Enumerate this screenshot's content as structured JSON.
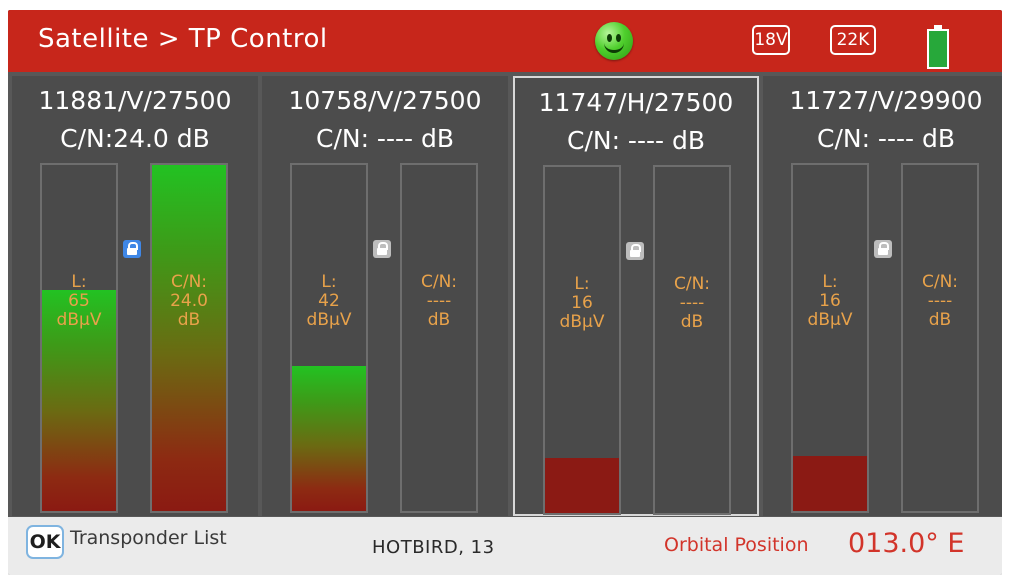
{
  "header": {
    "title": "Satellite > TP Control",
    "status_icon": "smiley-face-icon",
    "voltage_badge": "18V",
    "tone_badge": "22K",
    "battery_icon": "battery-icon",
    "colors": {
      "header_bg": "#c7261b",
      "accent_text": "#e8a24a"
    }
  },
  "panels": [
    {
      "frequency": "11881/V/27500",
      "cn_header": "C/N:24.0 dB",
      "locked": true,
      "level_label": "L:\n65\ndBµV",
      "level_value": 65,
      "level_fill_fraction": 0.64,
      "cn_label": "C/N:\n24.0\ndB",
      "cn_fill_fraction": 1.0,
      "selected": false
    },
    {
      "frequency": "10758/V/27500",
      "cn_header": "C/N: ---- dB",
      "locked": false,
      "level_label": "L:\n42\ndBµV",
      "level_value": 42,
      "level_fill_fraction": 0.42,
      "cn_label": "C/N:\n----\ndB",
      "cn_fill_fraction": 0,
      "selected": false
    },
    {
      "frequency": "11747/H/27500",
      "cn_header": "C/N: ---- dB",
      "locked": false,
      "level_label": "L:\n16\ndBµV",
      "level_value": 16,
      "level_fill_fraction": 0.16,
      "cn_label": "C/N:\n----\ndB",
      "cn_fill_fraction": 0,
      "selected": true
    },
    {
      "frequency": "11727/V/29900",
      "cn_header": "C/N: ---- dB",
      "locked": false,
      "level_label": "L:\n16\ndBµV",
      "level_value": 16,
      "level_fill_fraction": 0.16,
      "cn_label": "C/N:\n----\ndB",
      "cn_fill_fraction": 0,
      "selected": false
    }
  ],
  "footer": {
    "ok_key": "OK",
    "transponder_list": "Transponder List",
    "satellite": "HOTBIRD, 13",
    "orbital_label": "Orbital Position",
    "orbital_value": "013.0° E"
  }
}
